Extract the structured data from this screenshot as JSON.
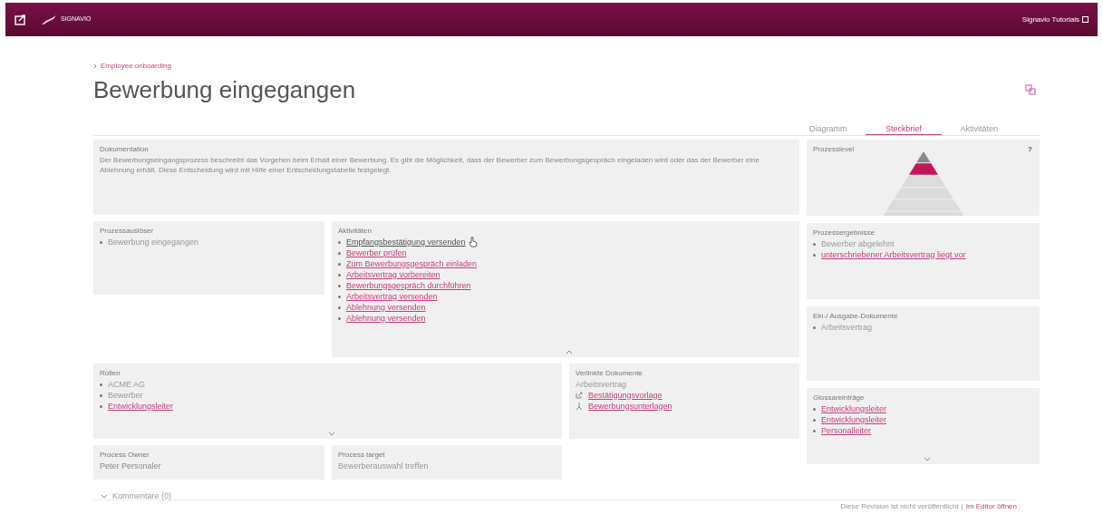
{
  "topbar": {
    "brand": "SIGNAVIO",
    "user_menu": "Signavio Tutorials"
  },
  "breadcrumb": "Employee onboarding",
  "title": "Bewerbung eingegangen",
  "tabs": [
    {
      "label": "Diagramm",
      "selected": false
    },
    {
      "label": "Steckbrief",
      "selected": true
    },
    {
      "label": "Aktivitäten",
      "selected": false
    }
  ],
  "documentation": {
    "label": "Dokumentation",
    "text": "Der Bewerbungseingangsprozess beschreibt das Vorgehen beim Erhalt einer Bewerbung. Es gibt die Möglichkeit, dass der Bewerber zum Bewerbungsgespräch eingeladen wird oder das der Bewerber eine Ablehnung erhält. Diese Entscheidung wird mit Hilfe einer Entscheidungstabelle festgelegt."
  },
  "process_level": {
    "label": "Prozesslevel",
    "help": "?",
    "tiers": [
      {
        "selected": false
      },
      {
        "selected": true
      },
      {
        "selected": false
      },
      {
        "selected": false
      },
      {
        "selected": false
      },
      {
        "selected": false
      }
    ]
  },
  "triggers": {
    "label": "Prozessauslöser",
    "items": [
      {
        "text": "Bewerbung eingegangen",
        "link": false
      }
    ]
  },
  "activities": {
    "label": "Aktivitäten",
    "expanded": true,
    "items": [
      {
        "text": "Empfangsbestätigung versenden",
        "link": true,
        "hovered": true
      },
      {
        "text": "Bewerber prüfen",
        "link": true,
        "hovered": false
      },
      {
        "text": "Zum Bewerbungsgespräch einladen",
        "link": true,
        "hovered": false
      },
      {
        "text": "Arbeitsvertrag vorbereiten",
        "link": true,
        "hovered": false
      },
      {
        "text": "Bewerbungsgespräch durchführen",
        "link": true,
        "hovered": false
      },
      {
        "text": "Arbeitsvertrag versenden",
        "link": true,
        "hovered": false
      },
      {
        "text": "Ablehnung versenden",
        "link": true,
        "hovered": false
      },
      {
        "text": "Ablehnung versenden",
        "link": true,
        "hovered": false
      }
    ]
  },
  "results": {
    "label": "Prozessergebnisse",
    "items": [
      {
        "text": "Bewerber abgelehnt",
        "link": false
      },
      {
        "text": "unterschriebener Arbeitsvertrag liegt vor",
        "link": true
      }
    ]
  },
  "io_documents": {
    "label": "Ein-/ Ausgabe-Dokumente",
    "items": [
      {
        "text": "Arbeitsvertrag",
        "link": false
      }
    ]
  },
  "roles": {
    "label": "Rollen",
    "expanded": false,
    "items": [
      {
        "text": "ACME AG",
        "link": false
      },
      {
        "text": "Bewerber",
        "link": false
      },
      {
        "text": "Entwicklungsleiter",
        "link": true
      }
    ]
  },
  "linked_documents": {
    "label": "Verlinkte Dokumente",
    "heading": "Arbeitsvertrag",
    "items": [
      {
        "text": "Bestätigungsvorlage",
        "kind": "external"
      },
      {
        "text": "Bewerbungsunterlagen",
        "kind": "pdf"
      }
    ]
  },
  "glossary": {
    "label": "Glossareinträge",
    "expanded": false,
    "items": [
      {
        "text": "Entwicklungsleiter",
        "link": true
      },
      {
        "text": "Entwicklungsleiter",
        "link": true
      },
      {
        "text": "Personalleiter",
        "link": true
      }
    ]
  },
  "process_owner": {
    "label": "Process Owner",
    "value": "Peter Personaler"
  },
  "process_target": {
    "label": "Process target",
    "value": "Bewerberauswahl treffen"
  },
  "comments": {
    "label": "Kommentare (0)",
    "expanded": false
  },
  "footer": {
    "status": "Diese Revision ist nicht veröffentlicht",
    "separator": "|",
    "link": "Im Editor öffnen"
  }
}
